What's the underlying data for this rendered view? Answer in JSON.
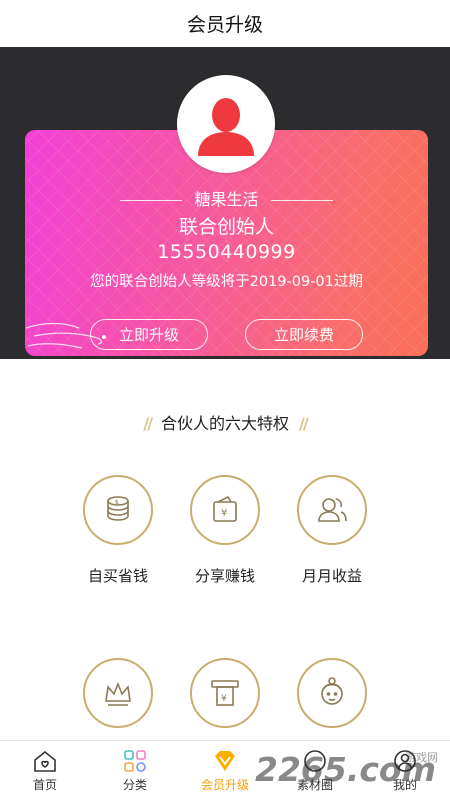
{
  "header": {
    "title": "会员升级"
  },
  "card": {
    "shop_name": "糖果生活",
    "level": "联合创始人",
    "phone": "15550440999",
    "expire_note": "您的联合创始人等级将于2019-09-01过期",
    "upgrade_label": "立即升级",
    "renew_label": "立即续费",
    "gradient_start": "#f23fd6",
    "gradient_end": "#fb6e58"
  },
  "privileges": {
    "title": "合伙人的六大特权",
    "accent_color": "#c8ad6d",
    "items": [
      {
        "label": "自买省钱",
        "icon": "coins-icon"
      },
      {
        "label": "分享赚钱",
        "icon": "wallet-icon"
      },
      {
        "label": "月月收益",
        "icon": "users-icon"
      },
      {
        "label": "",
        "icon": "crown-icon"
      },
      {
        "label": "",
        "icon": "atm-icon"
      },
      {
        "label": "",
        "icon": "girl-face-icon"
      }
    ]
  },
  "tabbar": {
    "active_color": "#f7a000",
    "tabs": [
      {
        "label": "首页",
        "icon": "home-icon"
      },
      {
        "label": "分类",
        "icon": "category-icon"
      },
      {
        "label": "会员升级",
        "icon": "diamond-icon",
        "active": true
      },
      {
        "label": "素材圈",
        "icon": "circle-icon"
      },
      {
        "label": "我的",
        "icon": "profile-icon"
      }
    ]
  },
  "watermark": {
    "text": "2265.com",
    "small_text": "游戏网"
  }
}
